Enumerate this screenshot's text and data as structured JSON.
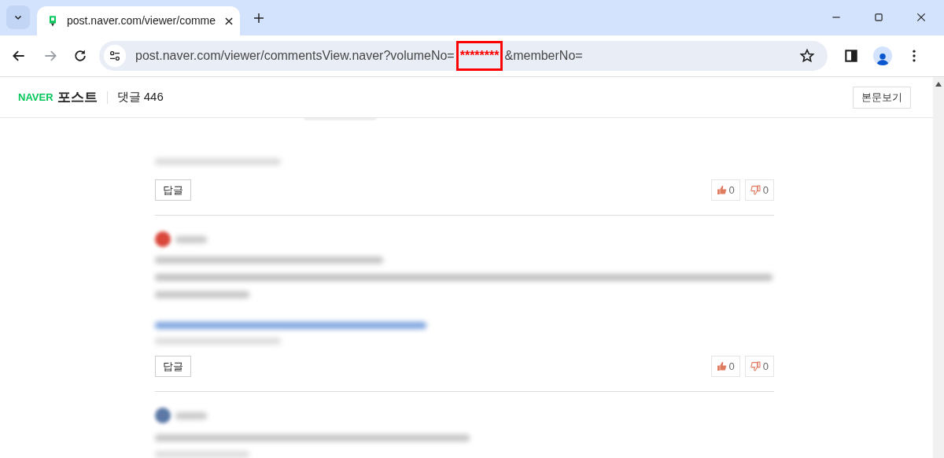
{
  "browser": {
    "tab_title": "post.naver.com/viewer/comme",
    "url_parts": [
      {
        "text": "post.naver.com/viewer/commentsView.naver?volumeNo=",
        "highlighted": false
      },
      {
        "text": "********",
        "highlighted": true
      },
      {
        "text": "&memberNo=",
        "highlighted": false
      }
    ]
  },
  "header": {
    "logo": "NAVER",
    "service": "포스트",
    "comment_count": "댓글 446",
    "view_post_button": "본문보기"
  },
  "comments": [
    {
      "kind": "tail",
      "reply_button": "답글",
      "likes": "0",
      "dislikes": "0"
    },
    {
      "kind": "full",
      "reply_button": "답글",
      "likes": "0",
      "dislikes": "0"
    },
    {
      "kind": "partial"
    }
  ]
}
